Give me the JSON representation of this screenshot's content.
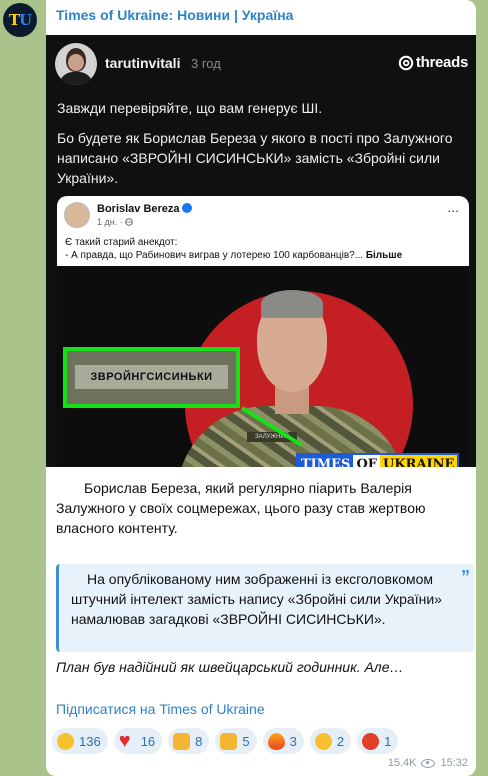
{
  "channel": {
    "name": "Times of Ukraine: Новини | Україна",
    "avatar_letters": [
      "T",
      "U"
    ],
    "colors": {
      "accent": "#2e83c8",
      "avatar_bg": "#0c1a2e",
      "avatar_t": "#ffd400",
      "avatar_u": "#2d7ee8"
    }
  },
  "threads_post": {
    "username": "tarutinvitali",
    "time": "3 год",
    "logo_text": "threads",
    "line1": "Завжди перевіряйте, що вам генерує ШІ.",
    "line2": "Бо будете як Борислав Береза у якого в пості про Залужного написано «ЗВРОЙНІ СИСИНСЬКИ» замість «Збройні сили України».",
    "facebook_card": {
      "name": "Borislav Bereza",
      "meta": "1 дн. · ",
      "dots": "...",
      "text_line1": "Є такий старий анекдот:",
      "text_line2": "- А правда, що Рабинович виграв у лотерею 100 карбованців?... ",
      "more": "Більше",
      "patch_text": "ЗВРОЙНГСИСИНЬКИ",
      "chest_tag": "ЗАЛУЖНИЙ",
      "watermark": {
        "times": "TIMES",
        "of": "OF",
        "ukraine": "UKRAINE"
      }
    }
  },
  "message": {
    "paragraph": "Борислав Береза, який регулярно піарить Валерія Залужного у своїх соцмережах, цього разу став жертвою власного контенту.",
    "quote": "На опублікованому ним зображенні із ексголовкомом штучний інтелект замість напису «Збройні сили України» намалював загадкові «ЗВРОЙНІ СИСИНСЬКИ».",
    "quote_mark": "”",
    "italic_line": "План був надійний як швейцарський годинник. Але…",
    "subscribe_link": "Підписатися на Times of Ukraine"
  },
  "reactions": [
    {
      "icon": "laughing-emoji-icon",
      "count": "136"
    },
    {
      "icon": "heart-emoji-icon",
      "count": "16"
    },
    {
      "icon": "thumbs-down-emoji-icon",
      "count": "8"
    },
    {
      "icon": "thumbs-up-emoji-icon",
      "count": "5"
    },
    {
      "icon": "fire-emoji-icon",
      "count": "3"
    },
    {
      "icon": "thinking-emoji-icon",
      "count": "2"
    },
    {
      "icon": "angry-emoji-icon",
      "count": "1"
    }
  ],
  "footer": {
    "views": "15.4K",
    "time": "15:32"
  }
}
